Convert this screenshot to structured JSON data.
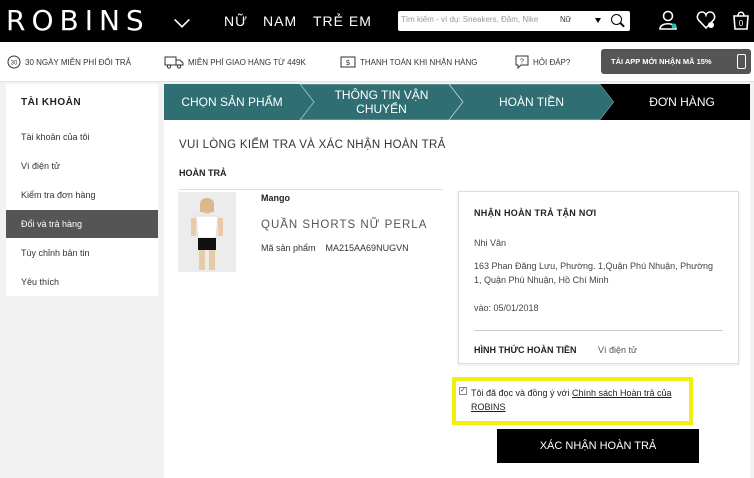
{
  "header": {
    "logo": "ROBINS",
    "nav": [
      "NỮ",
      "NAM",
      "TRẺ EM"
    ],
    "search": {
      "placeholder": "Tìm kiếm - ví dụ: Sneakers, Đầm, Nike",
      "category": "Nữ"
    },
    "icons": [
      "account-icon",
      "wishlist-icon",
      "cart-icon"
    ],
    "cart_count": "0"
  },
  "benefits": [
    {
      "icon": "return-30-icon",
      "badge": "30",
      "label": "30 NGÀY MIỄN PHÍ ĐỔI TRẢ"
    },
    {
      "icon": "truck-icon",
      "label": "MIỄN PHÍ GIAO HÀNG TỪ 449K"
    },
    {
      "icon": "cash-icon",
      "label": "THANH TOÁN KHI NHẬN HÀNG"
    },
    {
      "icon": "question-icon",
      "label": "HỎI ĐÁP?"
    }
  ],
  "app_promo": "TẢI APP MỚI NHẬN MÃ 15%",
  "sidebar": {
    "heading": "TÀI KHOẢN",
    "items": [
      {
        "label": "Tài khoản của tôi",
        "active": false
      },
      {
        "label": "Ví điện tử",
        "active": false
      },
      {
        "label": "Kiểm tra đơn hàng",
        "active": false
      },
      {
        "label": "Đổi và trả hàng",
        "active": true
      },
      {
        "label": "Tùy chỉnh bản tin",
        "active": false
      },
      {
        "label": "Yêu thích",
        "active": false
      }
    ]
  },
  "steps": [
    {
      "label": "CHỌN SẢN PHẨM",
      "state": "done"
    },
    {
      "label": "THÔNG TIN VẬN CHUYỂN",
      "state": "done"
    },
    {
      "label": "HOÀN TIỀN",
      "state": "done"
    },
    {
      "label": "ĐƠN HÀNG",
      "state": "current"
    }
  ],
  "page_title": "VUI LÒNG KIỂM TRA VÀ XÁC NHẬN HOÀN TRẢ",
  "return_section": "HOÀN TRẢ",
  "product": {
    "brand": "Mango",
    "name": "QUẦN SHORTS NỮ PERLA",
    "sku_label": "Mã sản phẩm",
    "sku": "MA215AA69NUGVN"
  },
  "pickup": {
    "heading": "NHẬN HOÀN TRẢ TẬN NƠI",
    "name": "Nhi Vân",
    "address": "163 Phan Đăng Lưu, Phường. 1,Quận Phú Nhuận, Phường 1, Quận Phú Nhuận, Hồ Chí Minh",
    "date": "vào: 05/01/2018",
    "refund_label": "HÌNH THỨC HOÀN TIỀN",
    "refund_value": "Ví điện tử"
  },
  "agreement": {
    "text": "Tôi đã đọc và đồng ý với ",
    "link": "Chính sách Hoàn trả của ROBINS",
    "checked": true
  },
  "confirm_button": "XÁC NHẬN HOÀN TRẢ",
  "colors": {
    "step_done": "#2f6f73",
    "step_current": "#000000",
    "highlight": "#f4ee0e"
  }
}
